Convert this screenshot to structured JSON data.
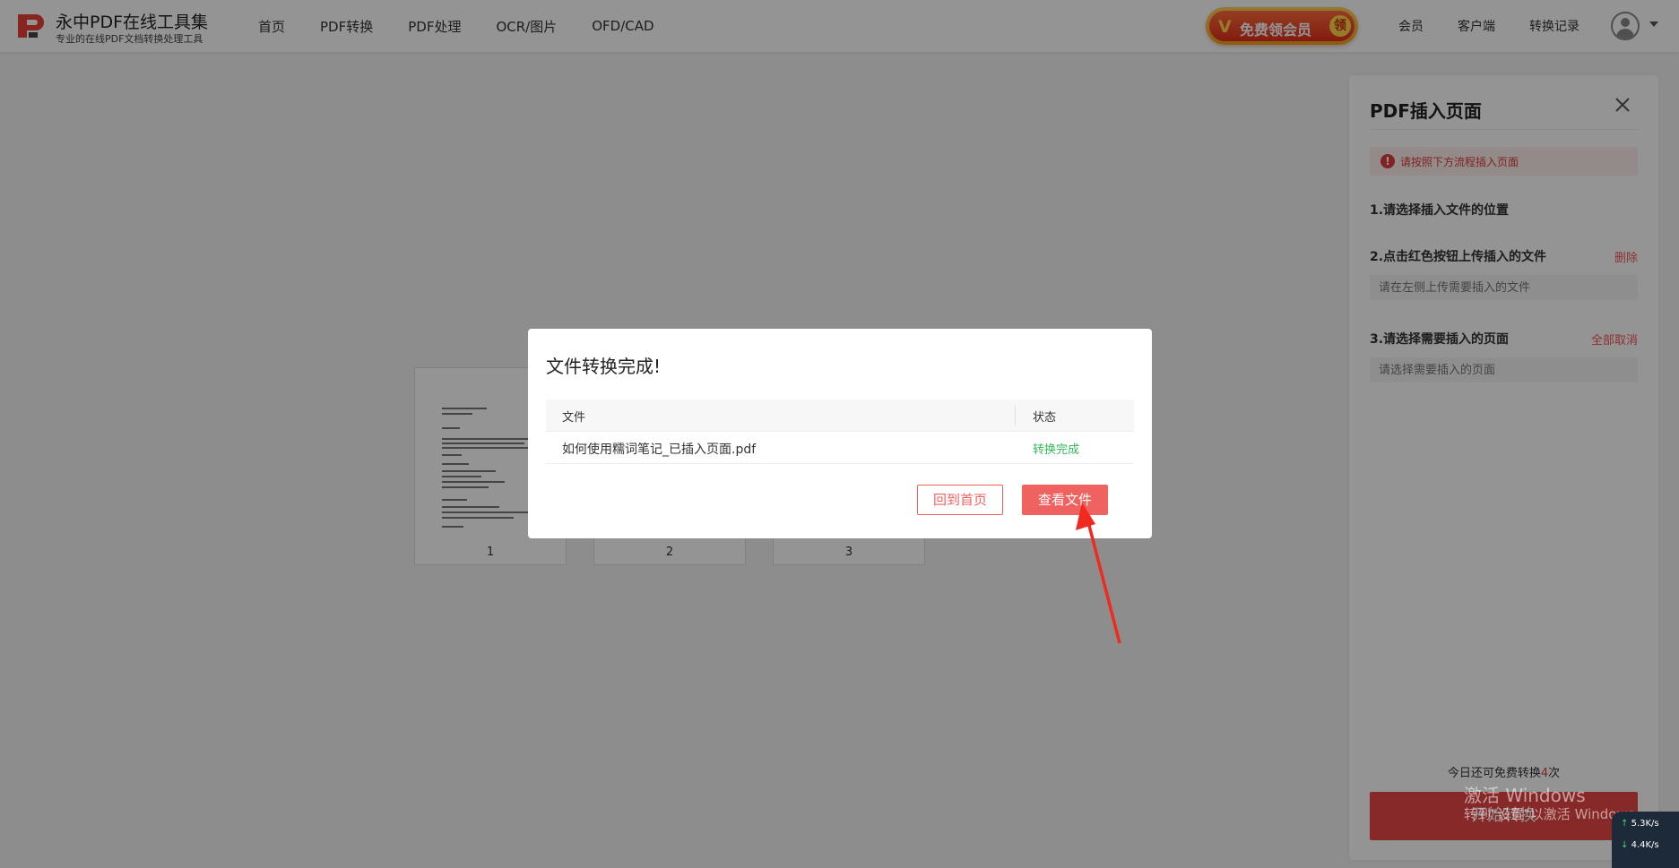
{
  "header": {
    "logo_title": "永中PDF在线工具集",
    "logo_subtitle": "专业的在线PDF文档转换处理工具",
    "nav": [
      "首页",
      "PDF转换",
      "PDF处理",
      "OCR/图片",
      "OFD/CAD"
    ],
    "vip_text": "免费领会员",
    "vip_claim": "领",
    "right_links": [
      "会员",
      "客户端",
      "转换记录"
    ]
  },
  "thumbnails": [
    "1",
    "2",
    "3"
  ],
  "panel": {
    "title": "PDF插入页面",
    "alert": "请按照下方流程插入页面",
    "step1": "1.请选择插入文件的位置",
    "step2": "2.点击红色按钮上传插入的文件",
    "step2_action": "删除",
    "step2_placeholder": "请在左侧上传需要插入的文件",
    "step3": "3.请选择需要插入的页面",
    "step3_action": "全部取消",
    "step3_placeholder": "请选择需要插入的页面",
    "remain_prefix": "今日还可免费转换",
    "remain_count": "4",
    "remain_suffix": "次",
    "start_button": "开始转换"
  },
  "dialog": {
    "title": "文件转换完成!",
    "col_file": "文件",
    "col_status": "状态",
    "rows": [
      {
        "file": "如何使用糯词笔记_已插入页面.pdf",
        "status": "转换完成"
      }
    ],
    "btn_home": "回到首页",
    "btn_view": "查看文件"
  },
  "watermark": {
    "line1": "激活 Windows",
    "line2": "转到\"设置\"以激活 Windows。"
  },
  "netspeed": {
    "up": "5.3",
    "up_unit": "K/s",
    "down": "4.4",
    "down_unit": "K/s"
  },
  "colors": {
    "accent": "#f0625f",
    "success": "#33b85a",
    "alert": "#e23b3b"
  }
}
